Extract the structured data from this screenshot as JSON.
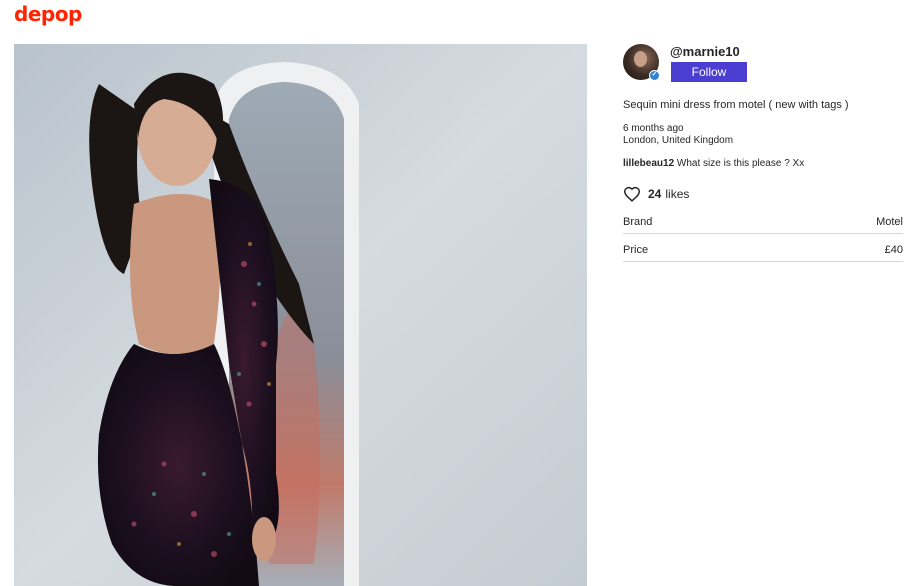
{
  "header": {
    "logo_text": "depop",
    "brand_color": "#ff2300"
  },
  "listing": {
    "photo_alt": "listing-photo",
    "seller": {
      "username": "@marnie10",
      "follow_label": "Follow",
      "follow_color": "#4b3fd1",
      "avatar_icon": "avatar",
      "verified_icon": "verified-badge-icon"
    },
    "description": "Sequin mini dress from motel ( new with tags )",
    "posted": "6 months ago",
    "location": "London, United Kingdom",
    "comment": {
      "user": "lillebeau12",
      "text": "What size is this please ? Xx"
    },
    "likes": {
      "icon": "heart-icon",
      "count": "24",
      "label": "likes"
    },
    "attributes": [
      {
        "key": "Brand",
        "value": "Motel"
      },
      {
        "key": "Price",
        "value": "£40"
      }
    ]
  }
}
